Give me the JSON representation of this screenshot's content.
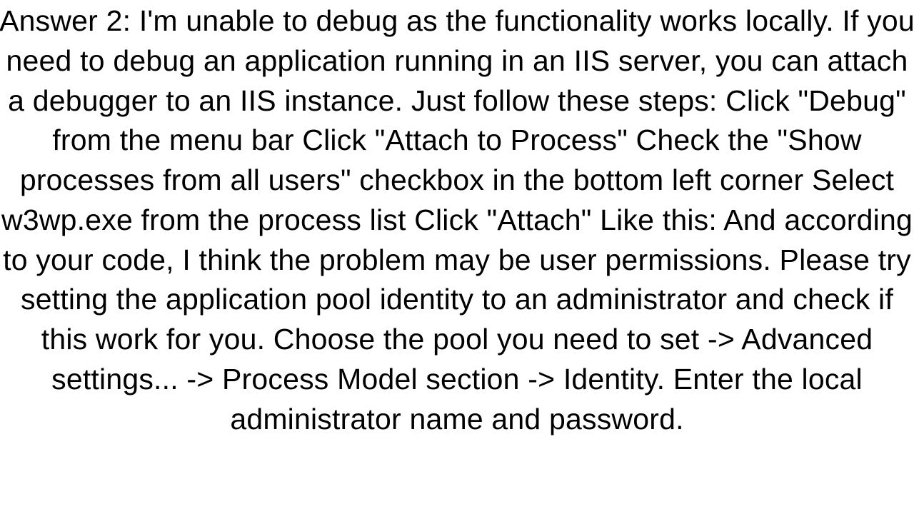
{
  "answer": {
    "label": "Answer 2:",
    "body": "I'm unable to debug as the functionality works locally.  If you need to debug an application running in an IIS server, you can attach a debugger to an IIS instance.  Just follow these steps:  Click \"Debug\" from the menu bar Click \"Attach to Process\" Check the \"Show processes from all users\" checkbox in the bottom left corner Select w3wp.exe from the process list Click \"Attach\"  Like this: And according to your code, I think the problem may be user permissions. Please try setting the application pool identity to an administrator and check if this work for you. Choose the pool you need to set -> Advanced settings... -> Process Model section -> Identity.   Enter the local administrator name and password."
  }
}
